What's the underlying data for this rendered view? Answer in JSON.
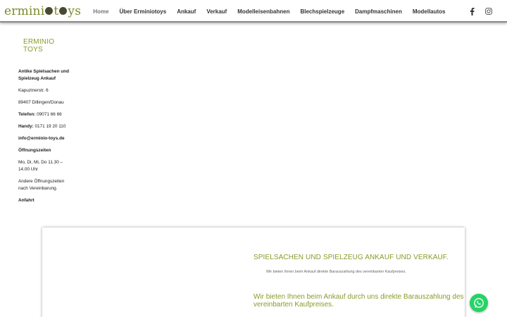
{
  "header": {
    "logo_text_1": "ermini",
    "logo_text_2": "t",
    "logo_text_3": "ys",
    "nav": [
      {
        "label": "Home",
        "active": true
      },
      {
        "label": "Über Erminiotoys"
      },
      {
        "label": "Ankauf"
      },
      {
        "label": "Verkauf"
      },
      {
        "label": "Modelleisenbahnen"
      },
      {
        "label": "Blechspielzeuge"
      },
      {
        "label": "Dampfmaschinen"
      },
      {
        "label": "Modellautos"
      }
    ],
    "social": [
      "facebook-icon",
      "instagram-icon"
    ]
  },
  "sidebar": {
    "title": "ERMINIO TOYS",
    "heading": "Antike Spielsachen und Spielzeug Ankauf",
    "street": "Kapuzinerstr. 6",
    "city": "89407 Dillingen/Donau",
    "phone_label": "Telefon:",
    "phone": " 09071 66 66",
    "mobile_label": "Handy:",
    "mobile": " 0171 19 20 110",
    "email": "info@erminio-toys.de",
    "hours_label": "Öffnungszeiten",
    "hours": "Mo, Di, Mi, Do 11.30 – 14.00 Uhr",
    "other_hours": "Andere Öffnungszeiten nach Vereinbarung.",
    "directions": "Anfahrt"
  },
  "content": {
    "heading": "SPIELSACHEN UND SPIELZEUG ANKAUF UND VERKAUF.",
    "subtext": "Wir bieten Ihnen beim Ankauf direkte Barauszahlung des vereinbarten Kaufpreises.",
    "heading2": "Wir bieten Ihnen beim Ankauf durch uns direkte Barauszahlung des vereinbarten Kaufpreises."
  },
  "colors": {
    "accent": "#8a9a28",
    "whatsapp": "#25d366"
  }
}
